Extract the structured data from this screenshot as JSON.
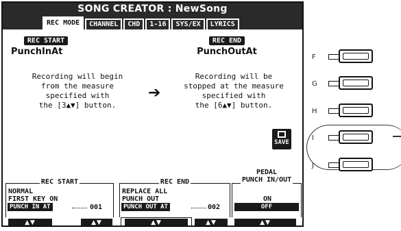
{
  "window": {
    "title": "SONG CREATOR : NewSong"
  },
  "tabs": [
    {
      "label": "REC MODE",
      "active": true
    },
    {
      "label": "CHANNEL",
      "active": false
    },
    {
      "label": "CHD",
      "active": false
    },
    {
      "label": "1-16",
      "active": false
    },
    {
      "label": "SYS/EX",
      "active": false
    },
    {
      "label": "LYRICS",
      "active": false
    }
  ],
  "rec_start": {
    "badge": "REC START",
    "param": "PunchInAt",
    "desc": [
      "Recording will begin",
      "from the measure",
      "specified with",
      "the [3▲▼] button."
    ]
  },
  "rec_end": {
    "badge": "REC END",
    "param": "PunchOutAt",
    "desc": [
      "Recording will be",
      "stopped at the measure",
      "specified with",
      "the [6▲▼] button."
    ]
  },
  "arrow": "➔",
  "save": {
    "label": "SAVE"
  },
  "bottom": {
    "rec_start": {
      "title": "REC START",
      "lines": [
        "NORMAL",
        "FIRST KEY ON"
      ],
      "selected": "PUNCH IN AT",
      "value": "001"
    },
    "rec_end": {
      "title": "REC END",
      "lines": [
        "REPLACE ALL",
        "PUNCH OUT"
      ],
      "selected": "PUNCH OUT AT",
      "value": "002"
    },
    "pedal": {
      "title_line1": "PEDAL",
      "title_line2": "PUNCH IN/OUT",
      "lines": [
        "ON"
      ],
      "selected": "OFF"
    },
    "arrow_symbol": "▲▼"
  },
  "panel_buttons": [
    "F",
    "G",
    "H",
    "I",
    "J"
  ],
  "highlighted_button": "I"
}
